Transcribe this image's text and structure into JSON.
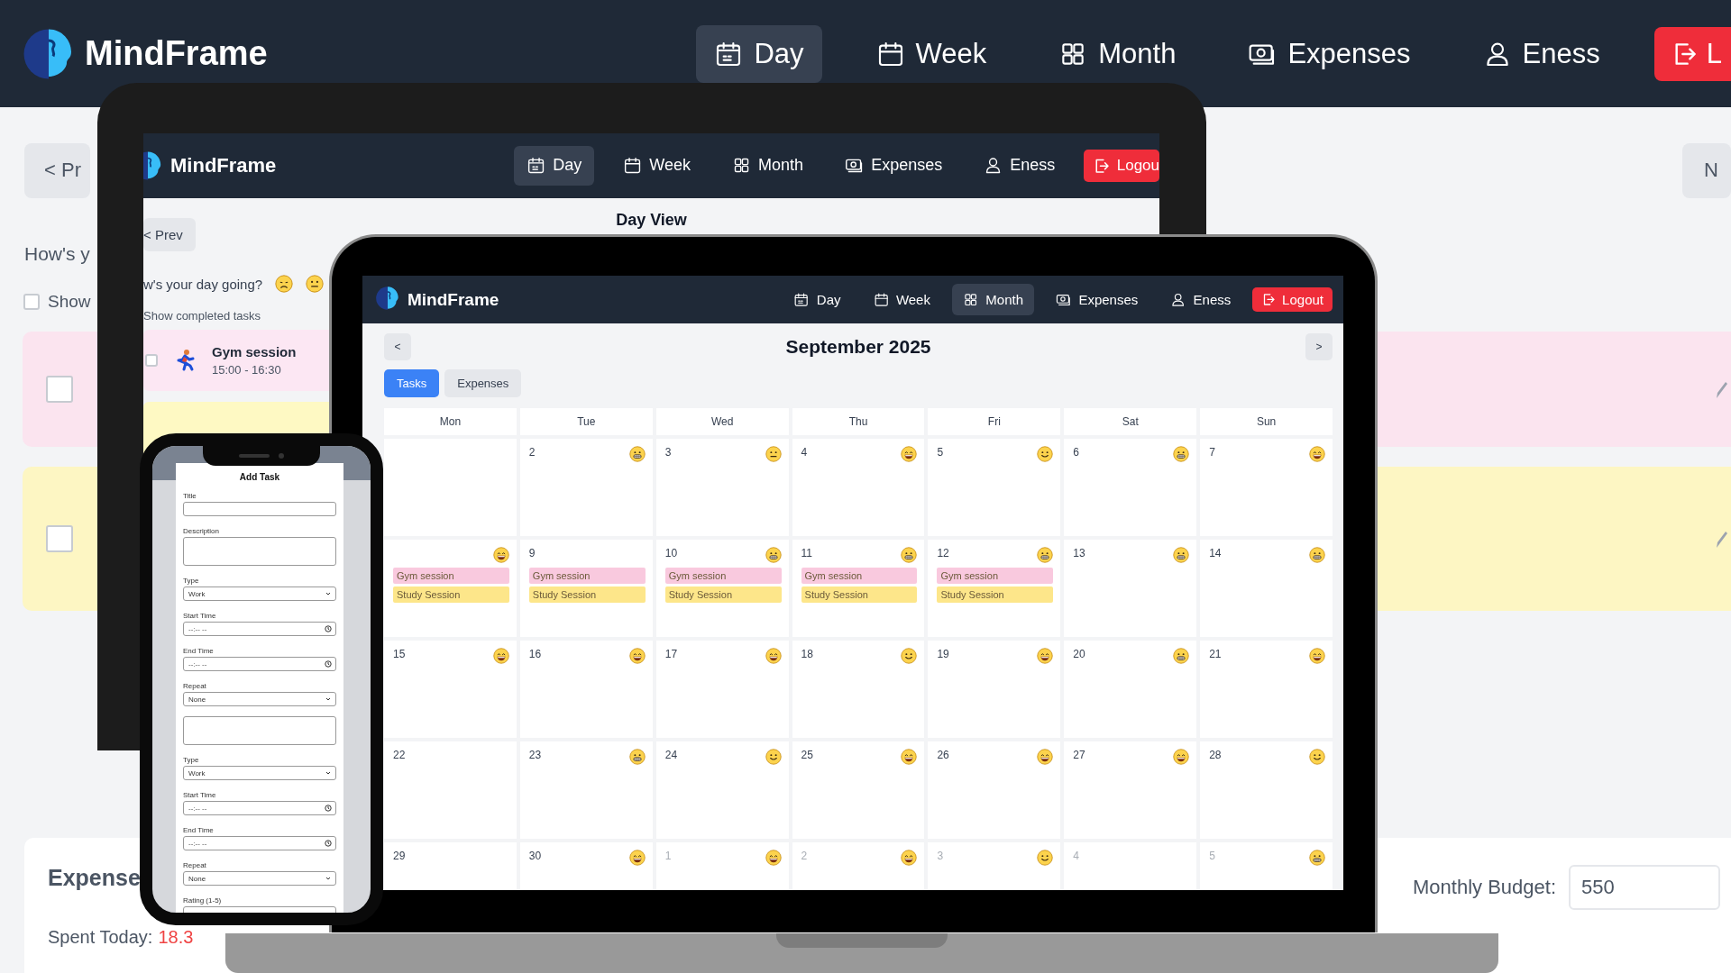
{
  "background_app": {
    "header": {
      "logo": "MindFrame",
      "nav": [
        {
          "label": "Day",
          "selected": true
        },
        {
          "label": "Week",
          "selected": false
        },
        {
          "label": "Month",
          "selected": false
        },
        {
          "label": "Expenses",
          "selected": false
        },
        {
          "label": "Eness",
          "selected": false
        }
      ],
      "logout": "L"
    },
    "prev_button": "< Pr",
    "next_button": "N",
    "mood_prompt": "How's y",
    "show_completed": {
      "label": "Show",
      "checked": false
    },
    "task_bands": [
      {
        "color": "#fbe4ef",
        "checked": false
      },
      {
        "color": "#fdf6c3",
        "checked": false
      }
    ],
    "expenses": {
      "title": "Expense",
      "spent_label": "Spent Today:",
      "spent_value": "18.3",
      "budget_label": "Monthly Budget:",
      "budget_value": "550"
    }
  },
  "back_laptop": {
    "header": {
      "logo": "MindFrame",
      "nav": [
        {
          "label": "Day",
          "selected": true
        },
        {
          "label": "Week",
          "selected": false
        },
        {
          "label": "Month",
          "selected": false
        },
        {
          "label": "Expenses",
          "selected": false
        },
        {
          "label": "Eness",
          "selected": false
        }
      ],
      "logout": "Logou"
    },
    "prev_button": "< Prev",
    "title": "Day View",
    "mood_prompt": "w's your day going?",
    "moods": [
      {
        "kind": "sad"
      },
      {
        "kind": "neutral"
      }
    ],
    "show_completed": "Show completed tasks",
    "tasks": [
      {
        "title": "Gym session",
        "time": "15:00 - 16:30",
        "color": "#fce7f3",
        "checked": false
      },
      {
        "color": "#fef9c3"
      }
    ]
  },
  "tablet": {
    "header": {
      "logo": "MindFrame",
      "nav": [
        {
          "label": "Day",
          "selected": false
        },
        {
          "label": "Week",
          "selected": false
        },
        {
          "label": "Month",
          "selected": true
        },
        {
          "label": "Expenses",
          "selected": false
        },
        {
          "label": "Eness",
          "selected": false
        }
      ],
      "logout": "Logout"
    },
    "prev_button": "<",
    "month_title": "September 2025",
    "next_button": ">",
    "tabs": [
      {
        "label": "Tasks",
        "selected": true
      },
      {
        "label": "Expenses",
        "selected": false
      }
    ],
    "weekdays": [
      "Mon",
      "Tue",
      "Wed",
      "Thu",
      "Fri",
      "Sat",
      "Sun"
    ],
    "weeks": [
      [
        {
          "kind": "blank"
        },
        {
          "day": "2",
          "mood": {
            "kind": "grin"
          },
          "muted": false
        },
        {
          "day": "3",
          "mood": {
            "kind": "neutral"
          },
          "muted": false
        },
        {
          "day": "4",
          "mood": {
            "kind": "laugh"
          },
          "muted": false
        },
        {
          "day": "5",
          "mood": {
            "kind": "smile"
          },
          "muted": false
        },
        {
          "day": "6",
          "mood": {
            "kind": "grin"
          },
          "muted": false
        },
        {
          "day": "7",
          "mood": {
            "kind": "laugh"
          },
          "muted": false
        }
      ],
      [
        {
          "mood": {
            "kind": "laugh"
          },
          "events": [
            {
              "title": "Gym session",
              "color": "#f9c9de"
            },
            {
              "title": "Study Session",
              "color": "#fde68a"
            }
          ]
        },
        {
          "day": "9",
          "muted": false,
          "events": [
            {
              "title": "Gym session",
              "color": "#f9c9de"
            },
            {
              "title": "Study Session",
              "color": "#fde68a"
            }
          ]
        },
        {
          "day": "10",
          "mood": {
            "kind": "grin"
          },
          "muted": false,
          "events": [
            {
              "title": "Gym session",
              "color": "#f9c9de"
            },
            {
              "title": "Study Session",
              "color": "#fde68a"
            }
          ]
        },
        {
          "day": "11",
          "mood": {
            "kind": "grin"
          },
          "muted": false,
          "events": [
            {
              "title": "Gym session",
              "color": "#f9c9de"
            },
            {
              "title": "Study Session",
              "color": "#fde68a"
            }
          ]
        },
        {
          "day": "12",
          "mood": {
            "kind": "grin"
          },
          "muted": false,
          "events": [
            {
              "title": "Gym session",
              "color": "#f9c9de"
            },
            {
              "title": "Study Session",
              "color": "#fde68a"
            }
          ]
        },
        {
          "day": "13",
          "mood": {
            "kind": "grin"
          },
          "muted": false
        },
        {
          "day": "14",
          "mood": {
            "kind": "grin"
          },
          "muted": false
        }
      ],
      [
        {
          "day": "15",
          "mood": {
            "kind": "laugh"
          },
          "muted": false
        },
        {
          "day": "16",
          "mood": {
            "kind": "laugh"
          },
          "muted": false
        },
        {
          "day": "17",
          "mood": {
            "kind": "laugh"
          },
          "muted": false
        },
        {
          "day": "18",
          "mood": {
            "kind": "smile"
          },
          "muted": false
        },
        {
          "day": "19",
          "mood": {
            "kind": "laugh"
          },
          "muted": false
        },
        {
          "day": "20",
          "mood": {
            "kind": "grin"
          },
          "muted": false
        },
        {
          "day": "21",
          "mood": {
            "kind": "laugh"
          },
          "muted": false
        }
      ],
      [
        {
          "day": "22",
          "muted": false
        },
        {
          "day": "23",
          "mood": {
            "kind": "grin"
          },
          "muted": false
        },
        {
          "day": "24",
          "mood": {
            "kind": "smile"
          },
          "muted": false
        },
        {
          "day": "25",
          "mood": {
            "kind": "laugh"
          },
          "muted": false
        },
        {
          "day": "26",
          "mood": {
            "kind": "laugh"
          },
          "muted": false
        },
        {
          "day": "27",
          "mood": {
            "kind": "laugh"
          },
          "muted": false
        },
        {
          "day": "28",
          "mood": {
            "kind": "smile"
          },
          "muted": false
        }
      ],
      [
        {
          "day": "29",
          "muted": false
        },
        {
          "day": "30",
          "mood": {
            "kind": "laugh"
          },
          "muted": false
        },
        {
          "day": "1",
          "mood": {
            "kind": "laugh"
          },
          "muted": true
        },
        {
          "day": "2",
          "mood": {
            "kind": "laugh"
          },
          "muted": true
        },
        {
          "day": "3",
          "mood": {
            "kind": "smile"
          },
          "muted": true
        },
        {
          "day": "4",
          "muted": true
        },
        {
          "day": "5",
          "mood": {
            "kind": "grin"
          },
          "muted": true
        }
      ]
    ]
  },
  "phone": {
    "title": "Add Task",
    "fields": [
      {
        "label": "Title",
        "kind": "text"
      },
      {
        "label": "Description",
        "kind": "textarea"
      },
      {
        "label": "Type",
        "kind": "select",
        "value": "Work"
      },
      {
        "label": "Start Time",
        "kind": "time",
        "placeholder": "--:-- --"
      },
      {
        "label": "End Time",
        "kind": "time",
        "placeholder": "--:-- --"
      },
      {
        "label": "Repeat",
        "kind": "select",
        "value": "None"
      },
      {
        "kind": "textarea"
      },
      {
        "label": "Type",
        "kind": "select",
        "value": "Work"
      },
      {
        "label": "Start Time",
        "kind": "time",
        "placeholder": "--:-- --"
      },
      {
        "label": "End Time",
        "kind": "time",
        "placeholder": "--:-- --"
      },
      {
        "label": "Repeat",
        "kind": "select",
        "value": "None"
      },
      {
        "label": "Rating (1-5)",
        "kind": "text"
      }
    ]
  }
}
